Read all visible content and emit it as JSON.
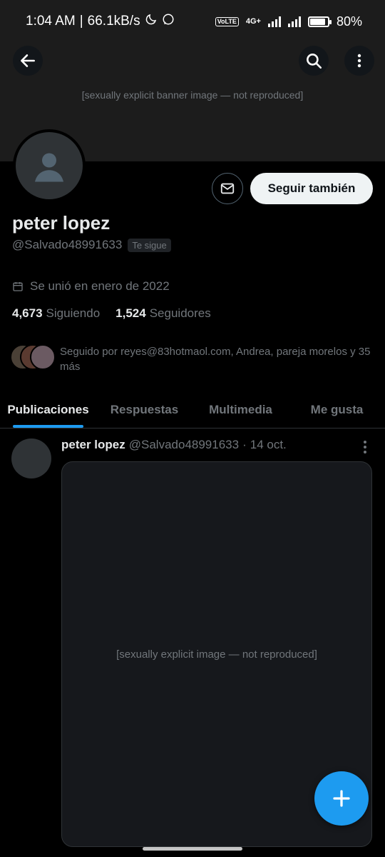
{
  "status_bar": {
    "time": "1:04 AM",
    "separator": "|",
    "net_speed": "66.1kB/s",
    "lte_badge": "VoLTE",
    "network_type": "4G+",
    "battery": "80%",
    "battery_level": 0.8
  },
  "banner": {
    "note": "[sexually explicit banner image — not reproduced]"
  },
  "header": {
    "back_icon": "arrow-left-icon",
    "search_icon": "search-icon",
    "more_icon": "more-vertical-icon"
  },
  "profile": {
    "name": "peter lopez",
    "handle": "@Salvado48991633",
    "follows_you": "Te sigue",
    "joined": "Se unió en enero de 2022",
    "following_count": "4,673",
    "following_label": "Siguiendo",
    "followers_count": "1,524",
    "followers_label": "Seguidores",
    "followed_by": "Seguido por reyes@83hotmaol.com, Andrea, pareja morelos y 35 más"
  },
  "actions": {
    "message_icon": "mail-icon",
    "follow_label": "Seguir también"
  },
  "tabs": [
    {
      "label": "Publicaciones",
      "active": true
    },
    {
      "label": "Respuestas",
      "active": false
    },
    {
      "label": "Multimedia",
      "active": false
    },
    {
      "label": "Me gusta",
      "active": false
    }
  ],
  "post": {
    "author_name": "peter lopez",
    "author_handle": "@Salvado48991633",
    "dot": "·",
    "date": "14 oct.",
    "media_note": "[sexually explicit image — not reproduced]"
  },
  "fab": {
    "icon": "plus-icon"
  },
  "colors": {
    "accent": "#1d9bf0",
    "background": "#000000",
    "text_primary": "#e7e9ea",
    "text_secondary": "#71767b"
  }
}
